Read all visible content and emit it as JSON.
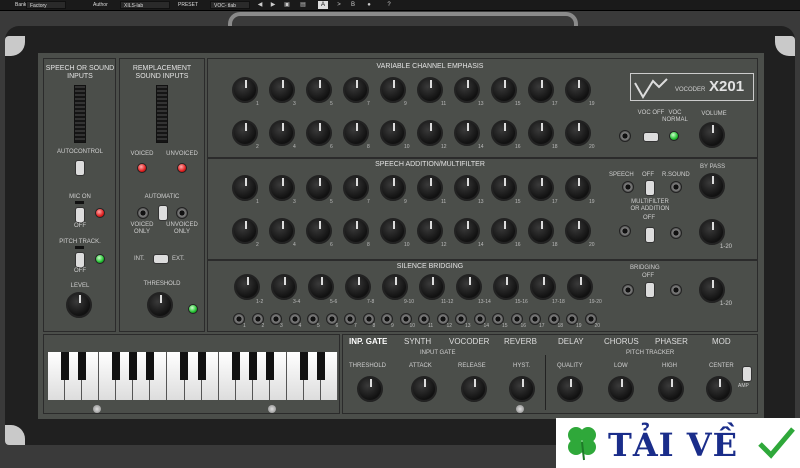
{
  "topbar": {
    "bank_label": "Bank",
    "bank_value": "Factory",
    "author_label": "Author",
    "author_value": "XILS-lab",
    "preset_label": "PRESET",
    "preset_value": "VOC- tlab"
  },
  "title": {
    "brand": "VOCODER",
    "model": "X201"
  },
  "sections": {
    "speech_inputs": "SPEECH OR SOUND INPUTS",
    "replacement_inputs": "REMPLACEMENT SOUND INPUTS",
    "channel_emphasis": "VARIABLE CHANNEL EMPHASIS",
    "speech_addition": "SPEECH ADDITION/MULTIFILTER",
    "silence_bridging": "SILENCE BRIDGING"
  },
  "left": {
    "autocontrol": "AUTOCONTROL",
    "mic_on": "MIC ON",
    "off1": "OFF",
    "pitch_track": "PITCH TRACK.",
    "off2": "OFF",
    "level": "LEVEL"
  },
  "mid": {
    "voiced": "VOICED",
    "unvoiced": "UNVOICED",
    "automatic": "AUTOMATIC",
    "voiced_only": "VOICED ONLY",
    "unvoiced_only": "UNVOICED ONLY",
    "int": "INT.",
    "ext": "EXT.",
    "threshold": "THRESHOLD"
  },
  "right": {
    "voc_off": "VOC OFF",
    "voc_normal": "VOC NORMAL",
    "volume": "VOLUME",
    "speech": "SPEECH",
    "off": "OFF",
    "r_sound": "R.SOUND",
    "bypass": "BY PASS",
    "multifilter": "MULTIFILTER OR ADDITION",
    "off_b": "OFF",
    "range": "1-20",
    "bridging": "BRIDGING",
    "bridging_off": "OFF",
    "range2": "1-20"
  },
  "channel_numbers_top": [
    "1",
    "3",
    "5",
    "7",
    "9",
    "11",
    "13",
    "15",
    "17",
    "19"
  ],
  "channel_numbers_bottom": [
    "2",
    "4",
    "6",
    "8",
    "10",
    "12",
    "14",
    "16",
    "18",
    "20"
  ],
  "bridging_numbers": [
    "1-2",
    "3-4",
    "5-6",
    "7-8",
    "9-10",
    "11-12",
    "13-14",
    "15-16",
    "17-18",
    "19-20"
  ],
  "jack_numbers": [
    "1",
    "2",
    "3",
    "4",
    "5",
    "6",
    "7",
    "8",
    "9",
    "10",
    "11",
    "12",
    "13",
    "14",
    "15",
    "16",
    "17",
    "18",
    "19",
    "20"
  ],
  "tabs": [
    "INP. GATE",
    "SYNTH",
    "VOCODER",
    "REVERB",
    "DELAY",
    "CHORUS",
    "PHASER",
    "MOD"
  ],
  "bottom": {
    "input_gate": "INPUT GATE",
    "threshold": "THRESHOLD",
    "attack": "ATTACK",
    "release": "RELEASE",
    "hyst": "HYST.",
    "pitch_tracker": "PITCH TRACKER",
    "quality": "QUALITY",
    "low": "LOW",
    "high": "HIGH",
    "center": "CENTER",
    "amp": "AMP"
  },
  "watermark": "TẢI VỀ",
  "colors": {
    "panel": "#4b4e4a",
    "led_red": "#e02020",
    "led_green": "#22c030",
    "watermark_blue": "#1a2d8a"
  }
}
